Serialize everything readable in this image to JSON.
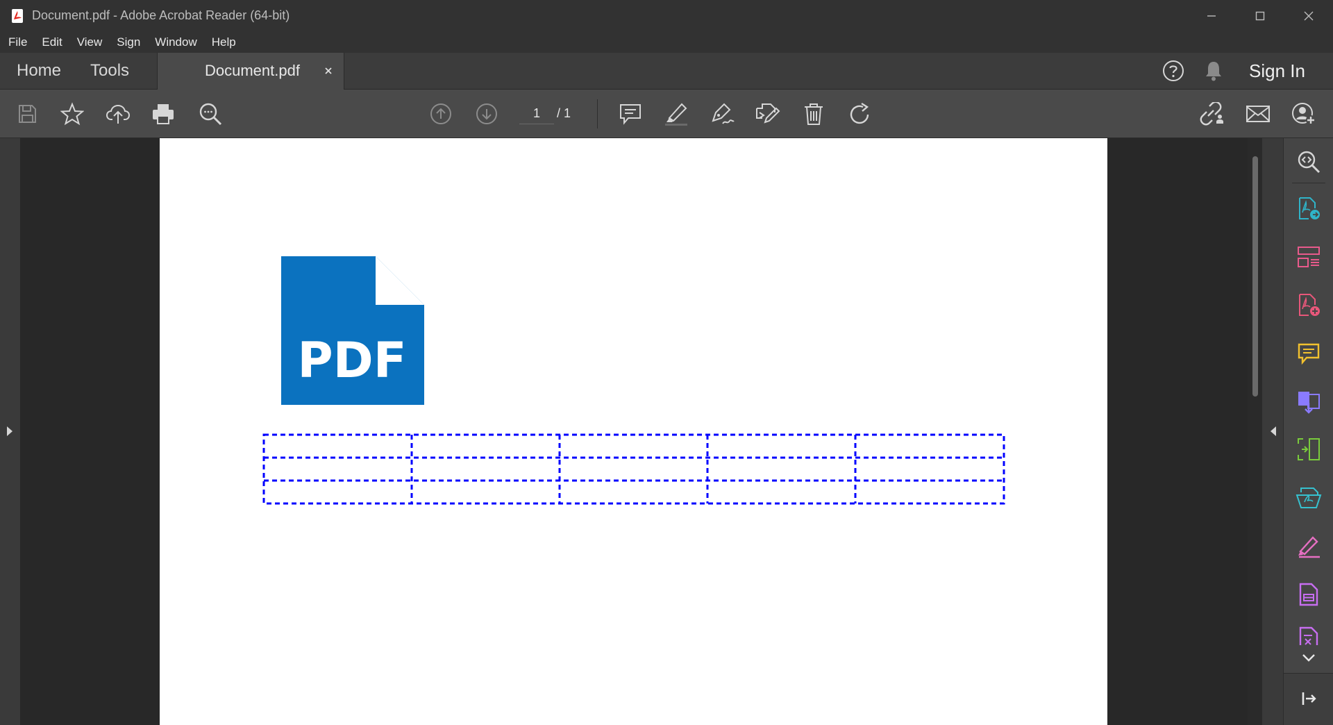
{
  "window": {
    "title": "Document.pdf - Adobe Acrobat Reader (64-bit)"
  },
  "menu": [
    "File",
    "Edit",
    "View",
    "Sign",
    "Window",
    "Help"
  ],
  "tabs": {
    "home": "Home",
    "tools": "Tools",
    "document": "Document.pdf",
    "sign_in": "Sign In"
  },
  "toolbar": {
    "current_page": "1",
    "total_pages": "/ 1"
  },
  "document": {
    "logo_text": "PDF",
    "table": {
      "rows": 3,
      "columns": 5,
      "border_color": "#0000ff",
      "border_style": "dashed"
    }
  },
  "colors": {
    "pdf_icon_blue": "#0b72bf",
    "tool_teal": "#2fb4c9",
    "tool_pink": "#e95a8c",
    "tool_red": "#e8577a",
    "tool_yellow": "#f2c12e",
    "tool_purple": "#8a7bff",
    "tool_green": "#7acb3c",
    "tool_cyan": "#36c1cf",
    "tool_magenta": "#e66fc2",
    "tool_violet": "#c76ef0"
  },
  "icons": {
    "toolbar": [
      "save-icon",
      "star-icon",
      "upload-cloud-icon",
      "print-icon",
      "zoom-search-icon",
      "page-up-icon",
      "page-down-icon",
      "comment-icon",
      "highlight-icon",
      "draw-sign-icon",
      "fill-sign-icon",
      "delete-icon",
      "rotate-icon",
      "share-link-icon",
      "email-icon",
      "share-user-icon"
    ],
    "right_rail": [
      "zoom-icon",
      "export-pdf-icon",
      "organize-pages-icon",
      "create-pdf-icon",
      "comment-icon",
      "combine-files-icon",
      "scan-ocr-icon",
      "send-track-icon",
      "fill-sign-icon",
      "protect-icon",
      "redact-icon",
      "scroll-down-icon",
      "collapse-panel-icon"
    ]
  }
}
